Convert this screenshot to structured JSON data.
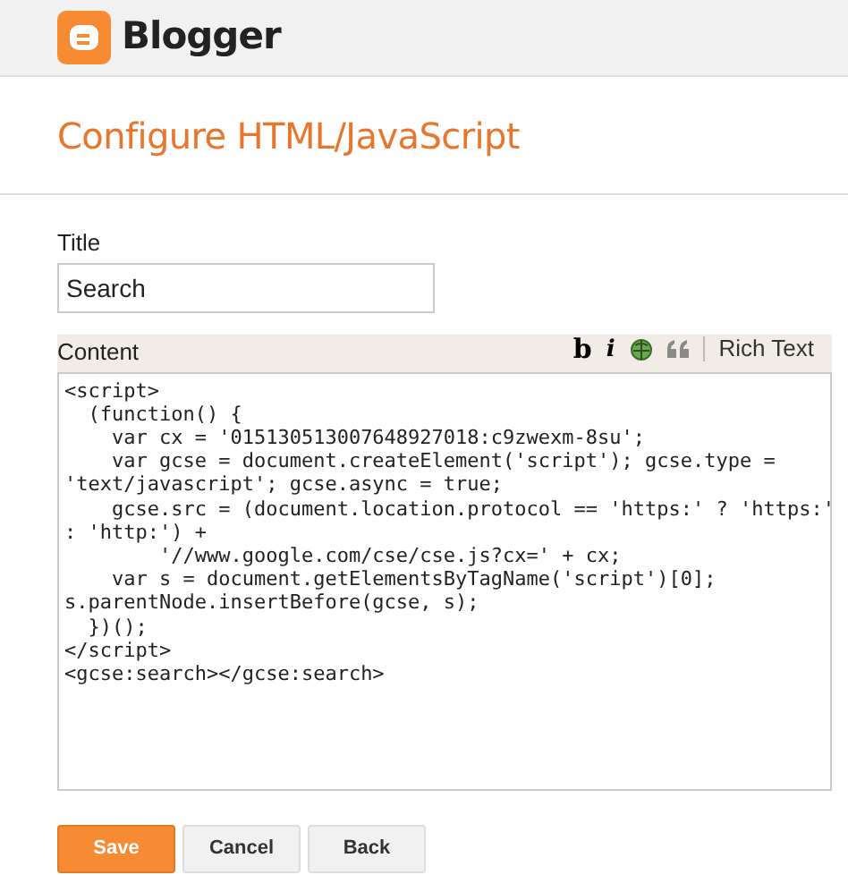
{
  "header": {
    "logo_text": "Blogger"
  },
  "page_title": "Configure HTML/JavaScript",
  "title_field": {
    "label": "Title",
    "value": "Search"
  },
  "content": {
    "label": "Content",
    "toolbar": [
      {
        "kind": "bold",
        "text": "b"
      },
      {
        "kind": "italic",
        "text": "i"
      },
      {
        "kind": "link"
      },
      {
        "kind": "quote"
      },
      {
        "kind": "divider"
      },
      {
        "kind": "mode",
        "text": "Rich Text"
      }
    ],
    "value": "<script>\n  (function() {\n    var cx = '015130513007648927018:c9zwexm-8su';\n    var gcse = document.createElement('script'); gcse.type =\n'text/javascript'; gcse.async = true;\n    gcse.src = (document.location.protocol == 'https:' ? 'https:'\n: 'http:') +\n        '//www.google.com/cse/cse.js?cx=' + cx;\n    var s = document.getElementsByTagName('script')[0];\ns.parentNode.insertBefore(gcse, s);\n  })();\n</script>\n<gcse:search></gcse:search>"
  },
  "buttons": [
    {
      "kind": "primary",
      "label": "Save"
    },
    {
      "kind": "secondary",
      "label": "Cancel"
    },
    {
      "kind": "secondary",
      "label": "Back"
    }
  ]
}
